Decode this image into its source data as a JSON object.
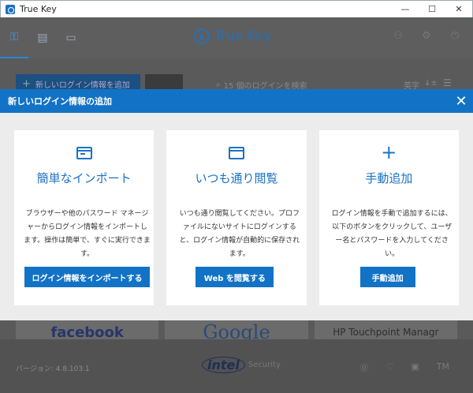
{
  "window": {
    "title": "True Key",
    "minimize": "—",
    "maximize": "☐",
    "close": "✕"
  },
  "header": {
    "brand": "True Key",
    "nav": [
      {
        "icon": "key-icon",
        "glyph": "⚿"
      },
      {
        "icon": "notes-icon",
        "glyph": "▤"
      },
      {
        "icon": "wallet-icon",
        "glyph": "▭"
      }
    ],
    "right": [
      {
        "icon": "profile-icon",
        "glyph": "⚇"
      },
      {
        "icon": "gear-icon",
        "glyph": "⚙"
      },
      {
        "icon": "power-icon",
        "glyph": "⏻"
      }
    ]
  },
  "toolbar": {
    "add_label": "新しいログイン情報を追加",
    "search_placeholder": "15 個のログインを検索",
    "sort_label": "英字",
    "sort_glyph": "↓±",
    "list_glyph": "☰"
  },
  "tiles": [
    "facebook",
    "Google",
    "HP Touchpoint Managr"
  ],
  "footer": {
    "version": "バージョン: 4.8.103.1",
    "intel": "intel",
    "security": "Security",
    "icons": [
      "⓪",
      "♡",
      "▣",
      "TM"
    ]
  },
  "modal": {
    "title": "新しいログイン情報の追加",
    "close": "✕",
    "cards": [
      {
        "title": "簡単なインポート",
        "desc": "ブラウザーや他のパスワード マネージャーからログイン情報をインポートします。操作は簡単で、すぐに実行できます。",
        "button": "ログイン情報をインポートする"
      },
      {
        "title": "いつも通り閲覧",
        "desc": "いつも通り閲覧してください。プロファイルにないサイトにログインすると、ログイン情報が自動的に保存されます。",
        "button": "Web を閲覧する"
      },
      {
        "title": "手動追加",
        "desc": "ログイン情報を手動で追加するには、以下のボタンをクリックして、ユーザー名とパスワードを入力してください。",
        "button": "手動追加"
      }
    ]
  },
  "colors": {
    "accent": "#1273c6",
    "title_blue": "#1a73c6"
  }
}
